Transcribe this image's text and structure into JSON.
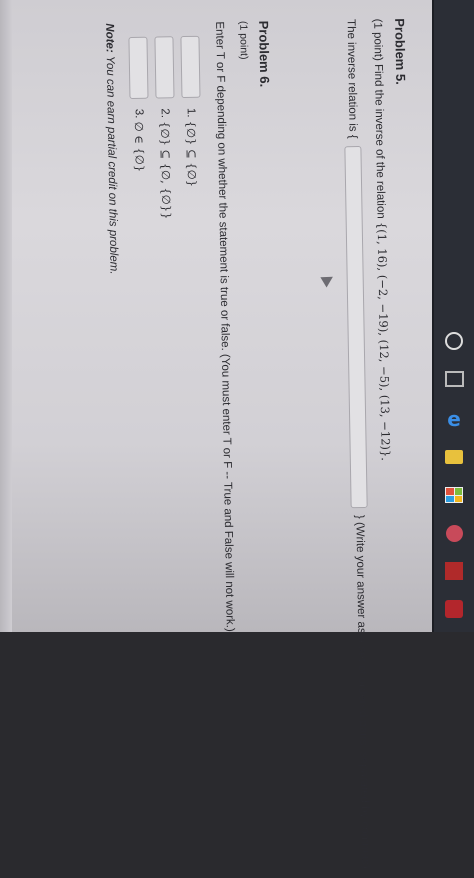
{
  "problem5": {
    "title": "Problem 5.",
    "points": "(1 point) Find the inverse of the relation",
    "relation": "{(1, 16), (−2, −19), (12, −5), (13, −12)}.",
    "prompt_start": "The inverse relation is {",
    "prompt_end": "}  (Write your answer as a set of ordered pairs, separated by commas).",
    "answer_value": ""
  },
  "problem6": {
    "title": "Problem 6.",
    "points": "(1 point)",
    "instructions": "Enter T or F depending on whether the statement is true or false. (You must enter T or F -- True and False will not work.)",
    "items": [
      {
        "label": "1.",
        "statement": "{∅} ⊆ {∅}",
        "value": ""
      },
      {
        "label": "2.",
        "statement": "{∅} ⊆ {∅, {∅}}",
        "value": ""
      },
      {
        "label": "3.",
        "statement": "∅ ∈ {∅}",
        "value": ""
      }
    ],
    "note_label": "Note:",
    "note_text": "You can earn partial credit on this problem."
  },
  "taskbar": {
    "icons": [
      "search-icon",
      "task-view-icon",
      "edge-icon",
      "file-explorer-icon",
      "store-icon",
      "app-circle-icon",
      "app-n-icon",
      "app-red-icon"
    ]
  }
}
